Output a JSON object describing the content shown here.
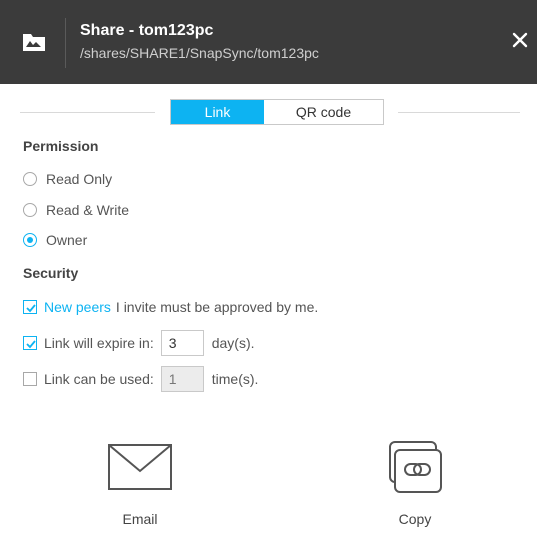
{
  "header": {
    "title": "Share - tom123pc",
    "path": "/shares/SHARE1/SnapSync/tom123pc",
    "folder_icon": "shared-folder-icon",
    "close_icon": "close-icon"
  },
  "tabs": [
    {
      "label": "Link",
      "active": true
    },
    {
      "label": "QR code",
      "active": false
    }
  ],
  "permission": {
    "title": "Permission",
    "options": [
      {
        "label": "Read Only",
        "checked": false
      },
      {
        "label": "Read & Write",
        "checked": false
      },
      {
        "label": "Owner",
        "checked": true
      }
    ]
  },
  "security": {
    "title": "Security",
    "new_peers": {
      "checked": true,
      "link_text": "New peers",
      "text": "I invite must be approved by me."
    },
    "expire": {
      "checked": true,
      "label": "Link will expire in:",
      "value": "3",
      "unit": "day(s)."
    },
    "usage": {
      "checked": false,
      "label": "Link can be used:",
      "value": "1",
      "unit": "time(s)."
    }
  },
  "actions": [
    {
      "label": "Email",
      "icon": "envelope-icon"
    },
    {
      "label": "Copy",
      "icon": "copy-link-icon"
    }
  ],
  "colors": {
    "accent": "#0db3f2",
    "header_bg": "#3b3b3b"
  }
}
